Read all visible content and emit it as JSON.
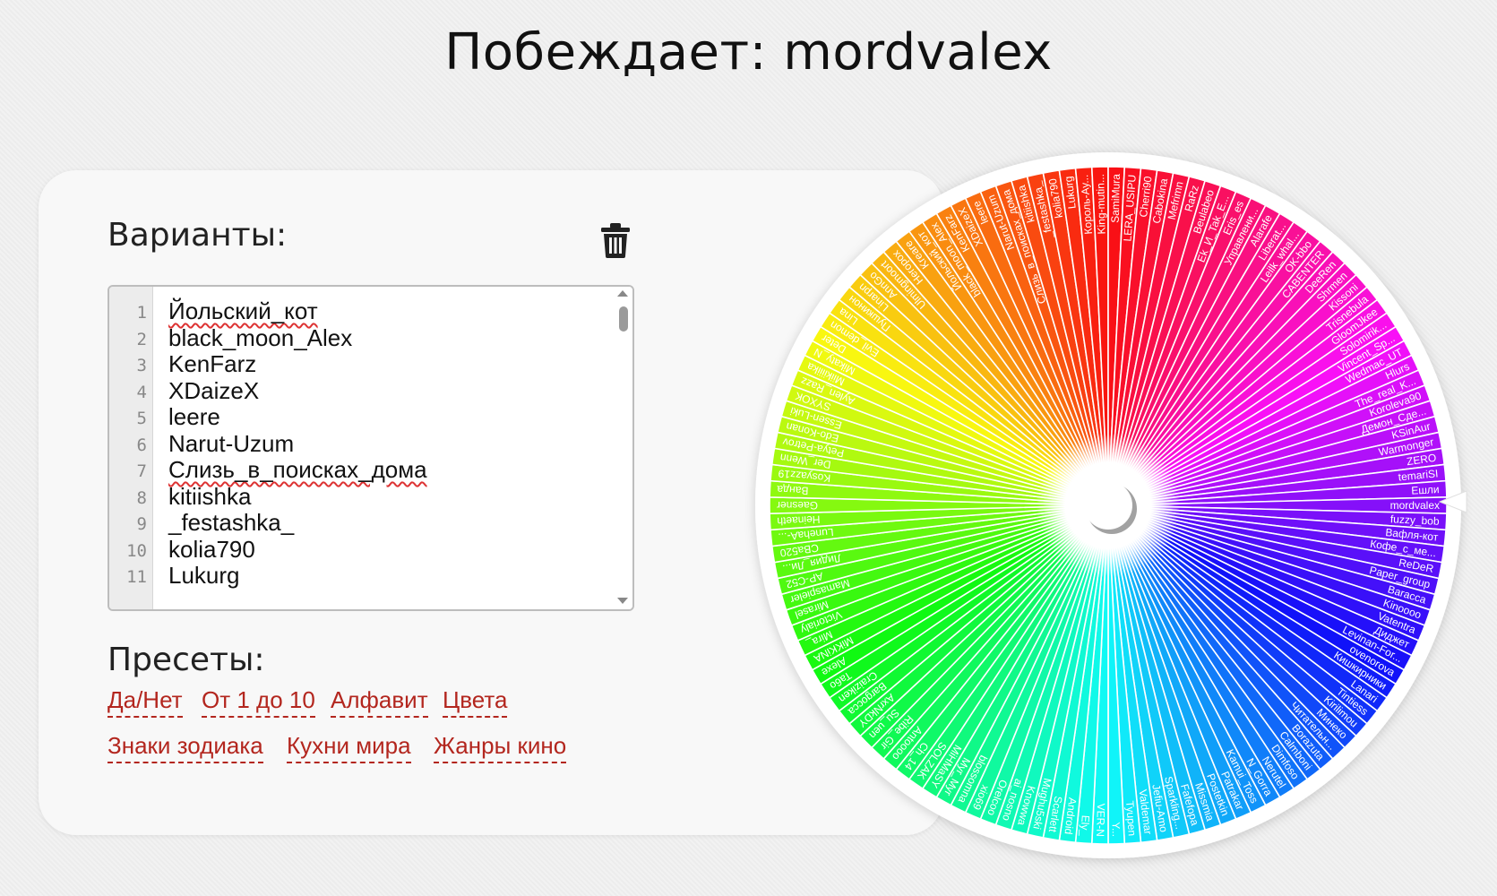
{
  "header": {
    "title": "Побеждает: mordvalex"
  },
  "variants": {
    "heading": "Варианты:",
    "clear_icon": "trash-icon",
    "lines": [
      {
        "num": "1",
        "text": "Йольский_кот",
        "misspelled": true
      },
      {
        "num": "2",
        "text": "black_moon_Alex",
        "misspelled": false
      },
      {
        "num": "3",
        "text": "KenFarz",
        "misspelled": false
      },
      {
        "num": "4",
        "text": "XDaizeX",
        "misspelled": false
      },
      {
        "num": "5",
        "text": "leere",
        "misspelled": false
      },
      {
        "num": "6",
        "text": "Narut-Uzum",
        "misspelled": false
      },
      {
        "num": "7",
        "text": "Слизь_в_поисках_дома",
        "misspelled": true
      },
      {
        "num": "8",
        "text": "kitiishka",
        "misspelled": false
      },
      {
        "num": "9",
        "text": "_festashka_",
        "misspelled": false
      },
      {
        "num": "10",
        "text": "kolia790",
        "misspelled": false
      },
      {
        "num": "11",
        "text": "Lukurg",
        "misspelled": false
      }
    ]
  },
  "presets": {
    "heading": "Пресеты:",
    "items": [
      "Да/Нет",
      "От 1 до 10",
      "Алфавит",
      "Цвета",
      "Знаки зодиака",
      "Кухни мира",
      "Жанры кино"
    ]
  },
  "wheel": {
    "labels": [
      "Йольский_кот",
      "black_moon_Alex",
      "KenFarz",
      "XDaizeX",
      "leere",
      "Narut-Uzum",
      "Слизь_в_поисках_дома",
      "kitiishka",
      "_festashka_",
      "kolia790",
      "Lukurg",
      "Король-Ау...",
      "King-mutin...",
      "SamiMura",
      "LERA_USIPU",
      "Cherri90",
      "Cabokina",
      "Mefrimn",
      "RaRz",
      "Beulabeo",
      "Ek_И_Tak_E...",
      "Eris_es",
      "Управлени...",
      "Alarafe",
      "Liberat...",
      "Leilk_whal...",
      "OK-bbo",
      "CABENTER",
      "DeeRen",
      "Shrmen",
      "Kissoni",
      "Trisnebula",
      "GloomJkee",
      "Solomirik...",
      "Vincent_Sp...",
      "Wedmac_UT",
      "Hlurs",
      "The_real_K...",
      "Koroleva90",
      "Демон_Сде...",
      "KSinAur",
      "Warmonger",
      "ZERO",
      "temariSI",
      "Ешли",
      "mordvalex",
      "fuzzy_bob",
      "Вафля-кот",
      "Кофе_с_ме...",
      "ReDeR",
      "Paper_group",
      "Baracca",
      "Kinoooo",
      "Vatentra",
      "Диджет",
      "Levinan-For...",
      "ovenorova",
      "Кишкирники",
      "Lanari",
      "Tintiess",
      "Kirilimou",
      "Минеко",
      "Читательн...",
      "Borazuta",
      "Calmboni",
      "Dimfoso",
      "Nerutel",
      "N_Gorra",
      "Kamui_Toss",
      "Patrakar",
      "Postetkin",
      "Missmia",
      "Fafefopa",
      "Sparkling...",
      "Jefiu-Amo",
      "Valdemar",
      "Tyupen",
      "Y...",
      "VER-N",
      "Ely_",
      "Android",
      "Scarlett",
      "Mughu5ski",
      "Knowwa",
      "ai_nosno",
      "Orelcoo",
      "xio69",
      "blossomna",
      "Myr_Myr",
      "MiHMaSY",
      "SOLZAK",
      "Ch_14",
      "Antoooo",
      "Ribe_Gir",
      "Su_uen",
      "AxrNkDY",
      "Bargocca",
      "Craiziken",
      "Ta6o",
      "Alexe",
      "MiKKiNA",
      "Mira_",
      "Victorialy",
      "Mirasel",
      "Mamaspieler",
      "AP-C52",
      "Лидия_Ли...",
      "CBa520",
      "LunehaA-...",
      "Heinaeth",
      "Gaesner",
      "Ванда",
      "Kosyazz19",
      "Der_Wenn",
      "Petya-Petrov",
      "Edo-Konan",
      "Essen-Luki",
      "SYXOK",
      "Aylen_Razz",
      "Miikiiiika",
      "Mikaty_N",
      "Deter",
      "Evil_demon",
      "Lina",
      "Пушкинон",
      "Linarpn",
      "AnnGo",
      "Ulmingmoort",
      "Heropox",
      "Kreare"
    ],
    "pointer_icon": "wheel-pointer-icon",
    "hub_icon": "wheel-hub-icon"
  }
}
